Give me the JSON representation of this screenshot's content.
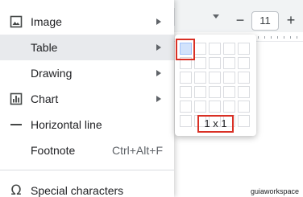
{
  "toolbar": {
    "font_size": "11",
    "minus": "−",
    "plus": "+"
  },
  "menu": {
    "items": [
      {
        "label": "Image",
        "icon": "image-icon",
        "submenu": true
      },
      {
        "label": "Table",
        "icon": "",
        "submenu": true,
        "active": true
      },
      {
        "label": "Drawing",
        "icon": "",
        "submenu": true
      },
      {
        "label": "Chart",
        "icon": "chart-icon",
        "submenu": true
      },
      {
        "label": "Horizontal line",
        "icon": "horizontal-line-icon"
      },
      {
        "label": "Footnote",
        "shortcut": "Ctrl+Alt+F"
      },
      {
        "label": "Special characters",
        "icon": "omega-icon"
      }
    ]
  },
  "table_picker": {
    "rows": 6,
    "cols": 5,
    "selected_rows": 1,
    "selected_cols": 1,
    "dimensions": "1 x 1"
  },
  "watermark": "guiaworkspace",
  "colors": {
    "highlight": "#d93025",
    "selected_cell": "#d2e3fc",
    "menu_active": "#e8eaed"
  }
}
